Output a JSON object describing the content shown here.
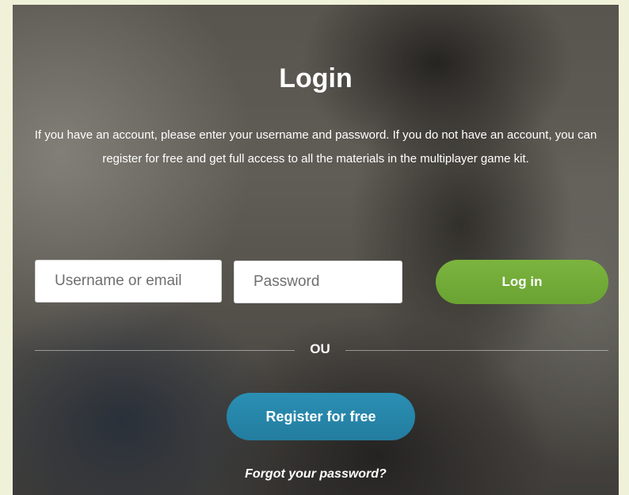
{
  "login": {
    "title": "Login",
    "description": "If you have an account, please enter your username and password. If you do not have an account, you can register for free and get full access to all the materials in the multiplayer game kit.",
    "username_placeholder": "Username or email",
    "password_placeholder": "Password",
    "login_button": "Log in",
    "divider_text": "OU",
    "register_button": "Register for free",
    "forgot_link": "Forgot your password?"
  },
  "colors": {
    "login_button": "#6aa332",
    "register_button": "#237da0",
    "page_border": "#eff1d9"
  }
}
